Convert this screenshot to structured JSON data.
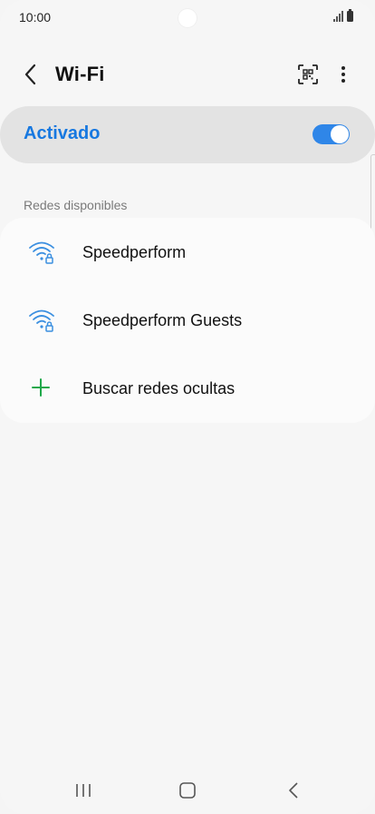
{
  "status_bar": {
    "time": "10:00"
  },
  "header": {
    "title": "Wi-Fi"
  },
  "master_switch": {
    "label": "Activado",
    "state": "on",
    "accent_color": "#2f86e8"
  },
  "available_networks": {
    "section_label": "Redes disponibles",
    "items": [
      {
        "label": "Speedperform",
        "icon": "wifi-lock-icon"
      },
      {
        "label": "Speedperform Guests",
        "icon": "wifi-lock-icon"
      },
      {
        "label": "Buscar redes ocultas",
        "icon": "plus-icon"
      }
    ]
  },
  "nav_bar": {
    "buttons": [
      "recent-apps-icon",
      "home-icon",
      "back-icon"
    ]
  }
}
